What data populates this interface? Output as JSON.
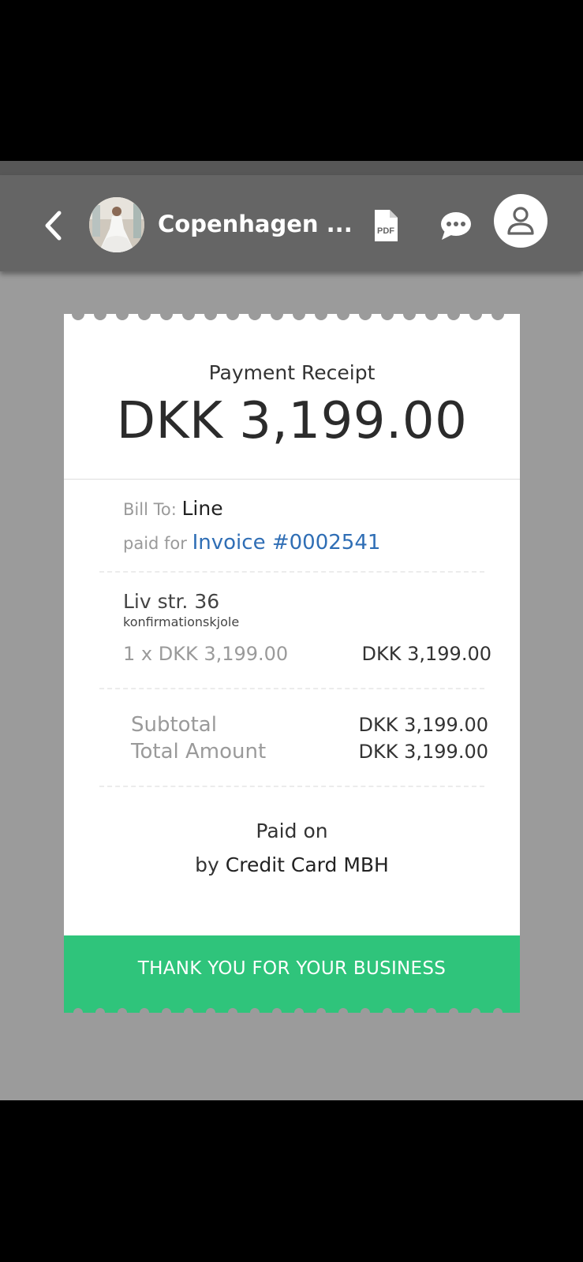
{
  "header": {
    "title": "Copenhagen ...",
    "back_icon": "chevron-left-icon",
    "avatar": "bride-photo",
    "pdf_icon_label": "PDF",
    "chat_icon": "chat-bubble-icon",
    "profile_icon": "user-icon"
  },
  "receipt": {
    "title": "Payment Receipt",
    "amount": "DKK 3,199.00",
    "bill_to_label": "Bill To:",
    "bill_to_name": "Line",
    "paid_for_label": "paid for",
    "invoice_link": "Invoice #0002541",
    "item": {
      "name": "Liv str. 36",
      "description": "konfirmationskjole",
      "quantity_price": "1 x DKK 3,199.00",
      "line_total": "DKK 3,199.00"
    },
    "subtotal_label": "Subtotal",
    "subtotal_value": "DKK 3,199.00",
    "total_label": "Total Amount",
    "total_value": "DKK 3,199.00",
    "paid_on": "Paid on",
    "paid_by_prefix": "by",
    "paid_by_method": "Credit Card MBH",
    "thanks": "THANK YOU FOR YOUR BUSINESS"
  },
  "colors": {
    "header_bg": "#656565",
    "screen_bg": "#9b9b9b",
    "accent_green": "#2fc47b",
    "link_blue": "#2f6eb5"
  }
}
